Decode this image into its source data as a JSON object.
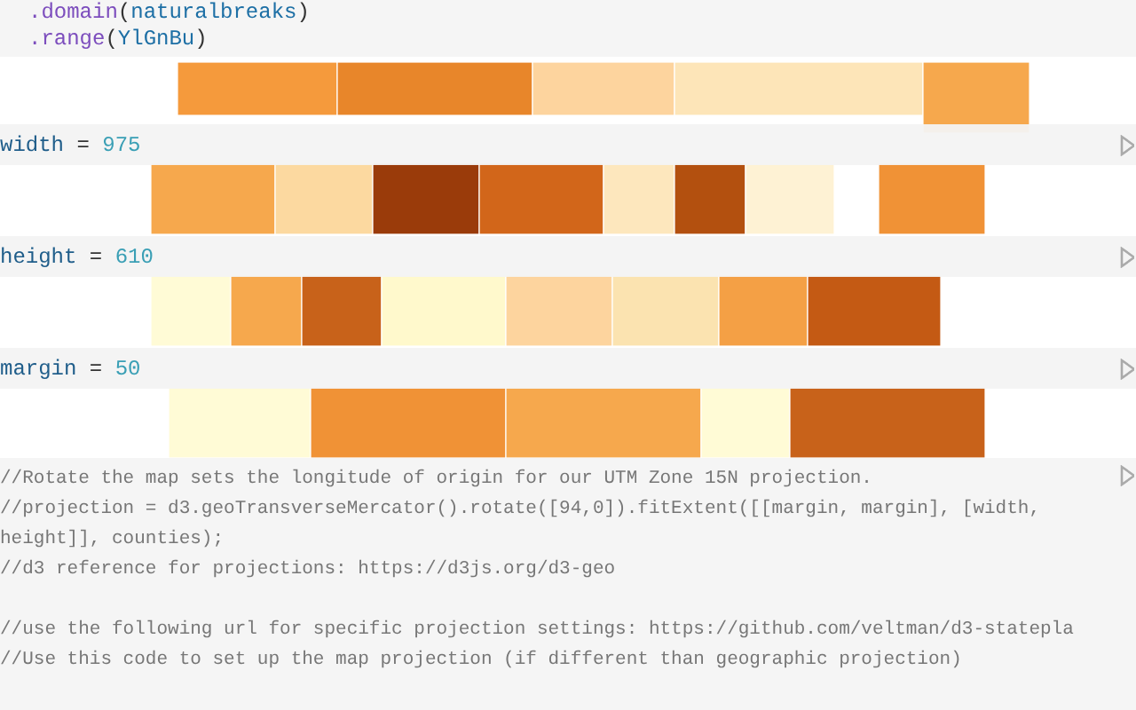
{
  "top_cell": {
    "lines": [
      [
        {
          "kind": "method",
          "text": ".domain"
        },
        {
          "kind": "punct",
          "text": "("
        },
        {
          "kind": "name",
          "text": "naturalbreaks"
        },
        {
          "kind": "punct",
          "text": ")"
        }
      ],
      [
        {
          "kind": "method",
          "text": ".range"
        },
        {
          "kind": "punct",
          "text": "("
        },
        {
          "kind": "name",
          "text": "YlGnBu"
        },
        {
          "kind": "punct",
          "text": ")"
        }
      ]
    ]
  },
  "cells": [
    {
      "name": "width",
      "operator": "=",
      "value": "975"
    },
    {
      "name": "height",
      "operator": "=",
      "value": "610"
    },
    {
      "name": "margin",
      "operator": "=",
      "value": "50"
    }
  ],
  "comment_cell": {
    "blocks": [
      [
        "//Rotate the map sets the longitude of origin for our UTM Zone 15N projection.",
        "//projection = d3.geoTransverseMercator().rotate([94,0]).fitExtent([[margin, margin], [width, height]], counties);",
        "//d3 reference for projections: https://d3js.org/d3-geo"
      ],
      [
        "//use the following url for specific projection settings: https://github.com/veltman/d3-statepla",
        "//Use this code to set up the map projection (if different than geographic projection)"
      ]
    ]
  }
}
